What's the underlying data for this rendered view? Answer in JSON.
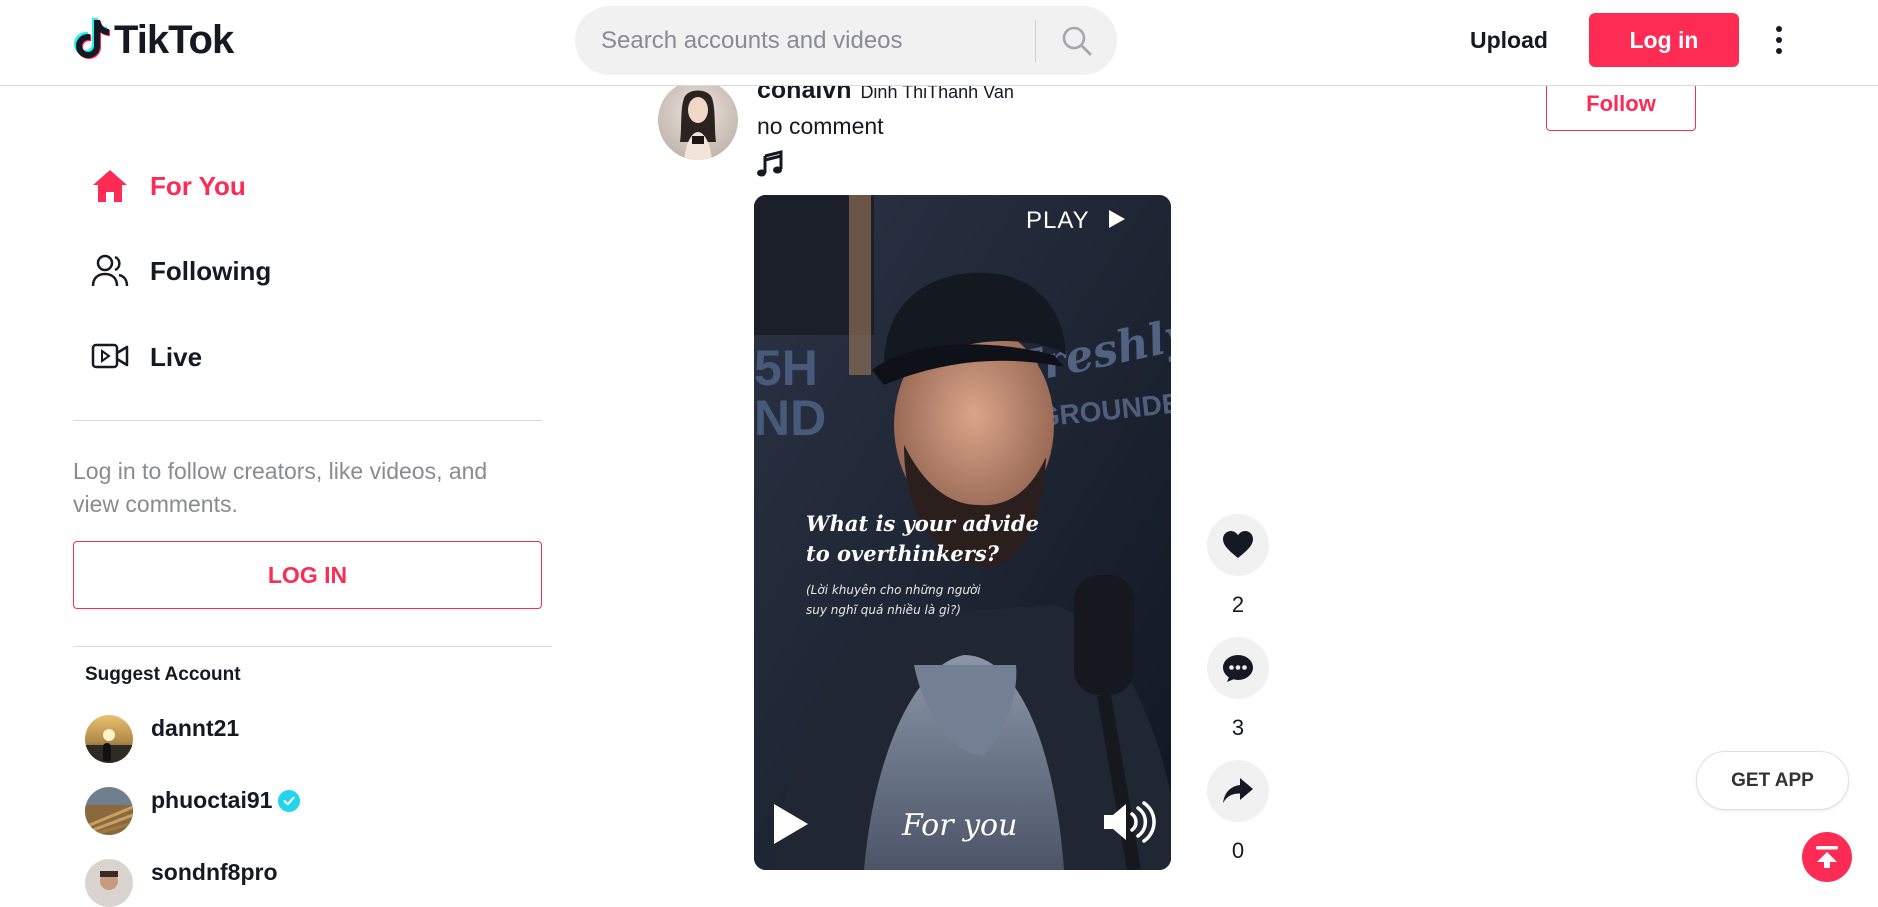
{
  "header": {
    "logo_text": "TikTok",
    "search_placeholder": "Search accounts and videos",
    "upload_label": "Upload",
    "login_label": "Log in"
  },
  "sidebar": {
    "nav": [
      {
        "label": "For You",
        "icon": "home-icon",
        "active": true
      },
      {
        "label": "Following",
        "icon": "users-icon",
        "active": false
      },
      {
        "label": "Live",
        "icon": "live-camera-icon",
        "active": false
      }
    ],
    "login_note": "Log in to follow creators, like videos, and view comments.",
    "login_button": "LOG IN",
    "suggest_title": "Suggest Account",
    "accounts": [
      {
        "username": "dannt21",
        "verified": false
      },
      {
        "username": "phuoctai91",
        "verified": true
      },
      {
        "username": "sondnf8pro",
        "verified": false
      }
    ]
  },
  "post": {
    "username": "conalvn",
    "nickname": "Dinh ThiThanh Van",
    "caption": "no comment",
    "follow_label": "Follow",
    "video": {
      "play_label": "PLAY",
      "overlay_line1": "What is your advide",
      "overlay_line2": "to overthinkers?",
      "overlay_sub1": "(Lời khuyên cho những người",
      "overlay_sub2": "suy nghĩ quá nhiều là gì?)",
      "watermark": "For you"
    },
    "likes": "2",
    "comments": "3",
    "shares": "0"
  },
  "floating": {
    "get_app_label": "GET APP"
  },
  "colors": {
    "brand": "#fe2c55",
    "text": "#161823",
    "muted": "#8a8b91",
    "verified": "#20d5ec"
  }
}
